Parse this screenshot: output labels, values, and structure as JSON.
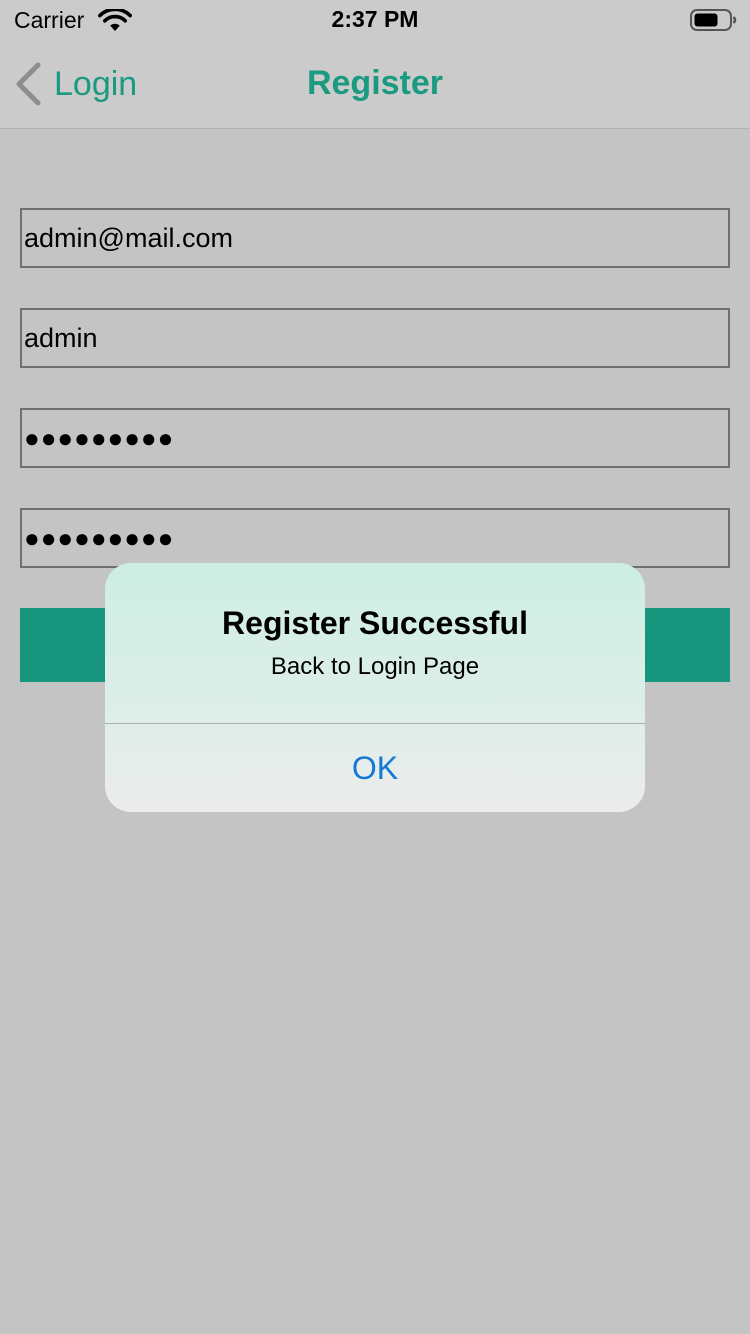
{
  "status_bar": {
    "carrier": "Carrier",
    "time": "2:37 PM",
    "icons": [
      "wifi-icon",
      "battery-icon"
    ]
  },
  "nav": {
    "back_label": "Login",
    "title": "Register",
    "accent_color": "#1a9a80",
    "icons": [
      "chevron-left-icon"
    ]
  },
  "form": {
    "email_value": "admin@mail.com",
    "username_value": "admin",
    "password_mask": "●●●●●●●●●",
    "confirm_password_mask": "●●●●●●●●●",
    "button_color": "#18967d"
  },
  "alert": {
    "title": "Register Successful",
    "message": "Back to Login Page",
    "ok_label": "OK",
    "ok_color": "#1479d6"
  }
}
